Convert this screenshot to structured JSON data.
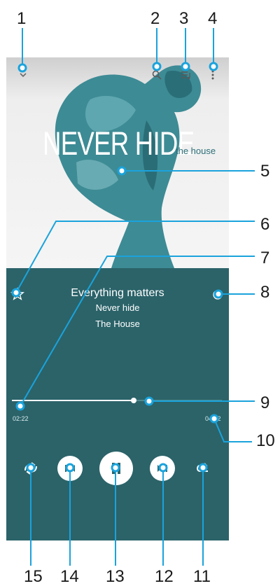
{
  "album_art": {
    "title": "NEVER HIDE",
    "subtitle": "the house"
  },
  "track": {
    "song": "Everything matters",
    "album": "Never hide",
    "artist": "The House"
  },
  "playback": {
    "elapsed": "02:22",
    "duration": "04:22",
    "progress_fraction": 0.58,
    "state": "playing"
  },
  "colors": {
    "panel": "#2b6369",
    "callout_line": "#1aa3dc"
  },
  "callouts": {
    "n1": "1",
    "n2": "2",
    "n3": "3",
    "n4": "4",
    "n5": "5",
    "n6": "6",
    "n7": "7",
    "n8": "8",
    "n9": "9",
    "n10": "10",
    "n11": "11",
    "n12": "12",
    "n13": "13",
    "n14": "14",
    "n15": "15"
  },
  "icons": {
    "minimize": "chevron-down-icon",
    "search": "search-icon",
    "queue": "queue-icon",
    "menu": "more-vert-icon",
    "favorite": "star-icon",
    "visualizer": "visualizer-icon",
    "repeat": "repeat-icon",
    "next": "skip-next-icon",
    "pause": "pause-icon",
    "previous": "skip-previous-icon",
    "shuffle": "shuffle-icon"
  }
}
